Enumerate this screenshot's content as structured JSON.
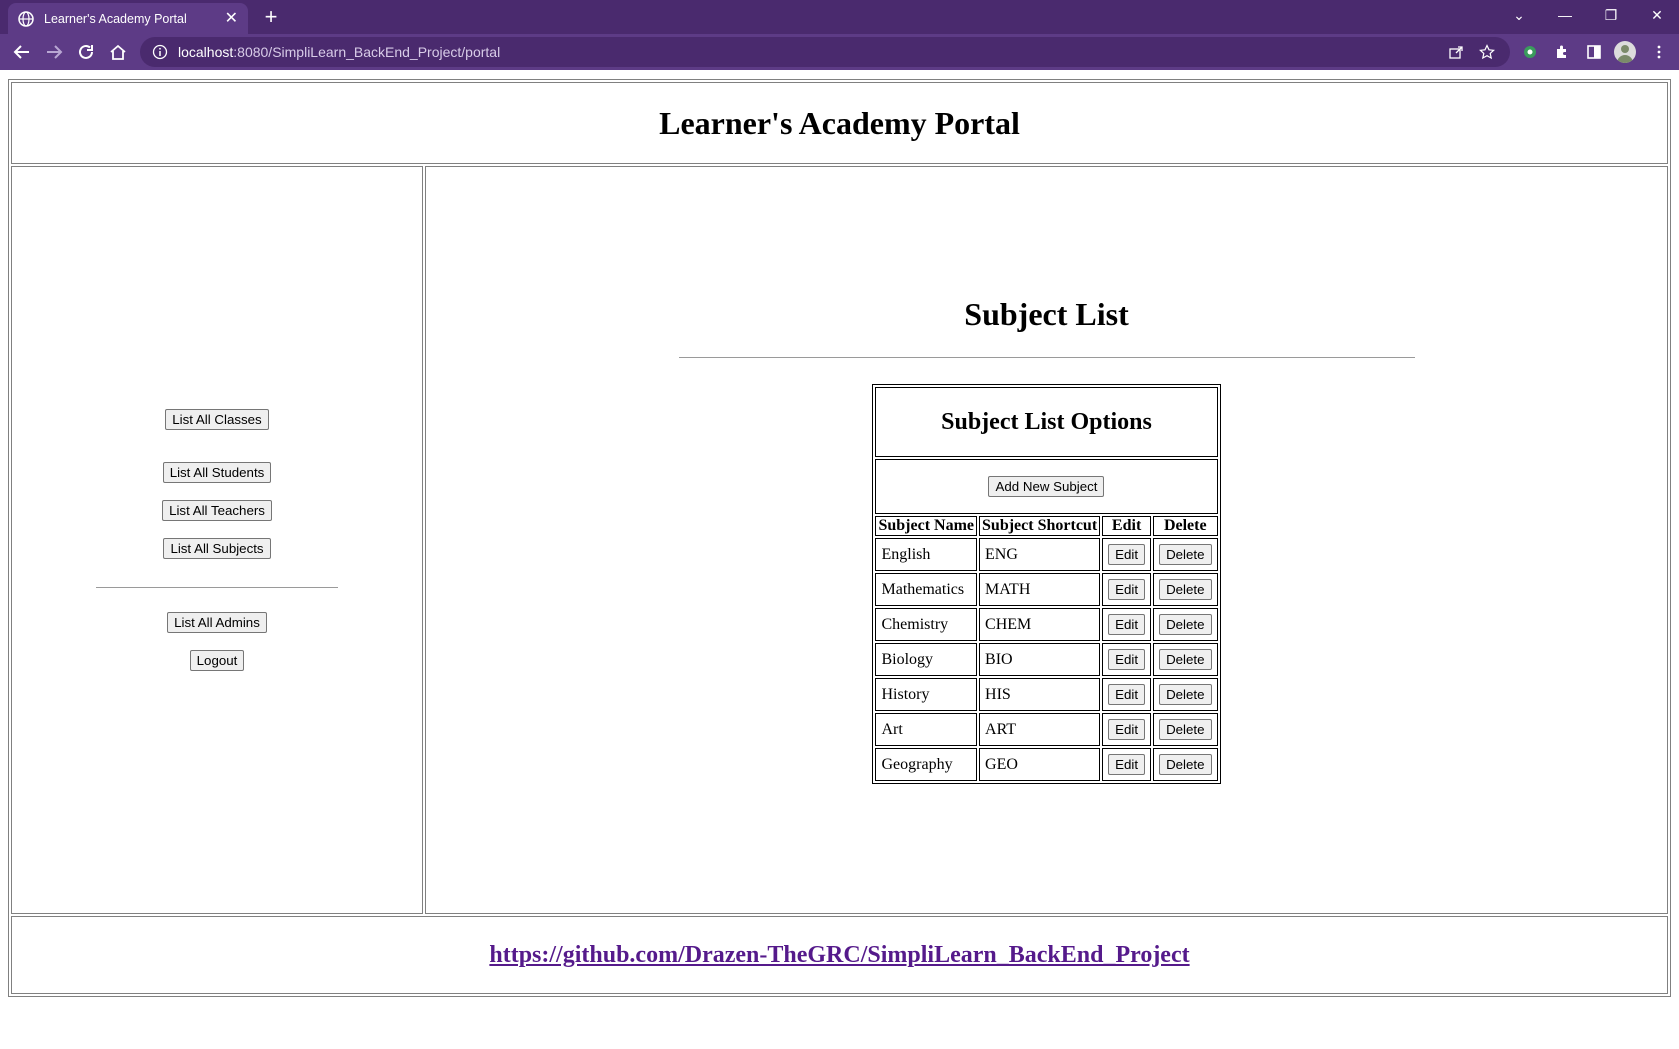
{
  "browser": {
    "tab_title": "Learner's Academy Portal",
    "url_host": "localhost",
    "url_path": ":8080/SimpliLearn_BackEnd_Project/portal"
  },
  "page": {
    "title": "Learner's Academy Portal",
    "footer_link": "https://github.com/Drazen-TheGRC/SimpliLearn_BackEnd_Project"
  },
  "sidebar": {
    "list_classes": "List All Classes",
    "list_students": "List All Students",
    "list_teachers": "List All Teachers",
    "list_subjects": "List All Subjects",
    "list_admins": "List All Admins",
    "logout": "Logout"
  },
  "main": {
    "heading": "Subject List",
    "options_title": "Subject List Options",
    "add_button": "Add New Subject",
    "columns": [
      "Subject Name",
      "Subject Shortcut",
      "Edit",
      "Delete"
    ],
    "rows": [
      {
        "name": "English",
        "shortcut": "ENG",
        "edit": "Edit",
        "delete": "Delete"
      },
      {
        "name": "Mathematics",
        "shortcut": "MATH",
        "edit": "Edit",
        "delete": "Delete"
      },
      {
        "name": "Chemistry",
        "shortcut": "CHEM",
        "edit": "Edit",
        "delete": "Delete"
      },
      {
        "name": "Biology",
        "shortcut": "BIO",
        "edit": "Edit",
        "delete": "Delete"
      },
      {
        "name": "History",
        "shortcut": "HIS",
        "edit": "Edit",
        "delete": "Delete"
      },
      {
        "name": "Art",
        "shortcut": "ART",
        "edit": "Edit",
        "delete": "Delete"
      },
      {
        "name": "Geography",
        "shortcut": "GEO",
        "edit": "Edit",
        "delete": "Delete"
      }
    ]
  },
  "colors": {
    "chrome_dark": "#4a2a6e",
    "chrome_light": "#5d3b86",
    "link": "#551a8b"
  }
}
